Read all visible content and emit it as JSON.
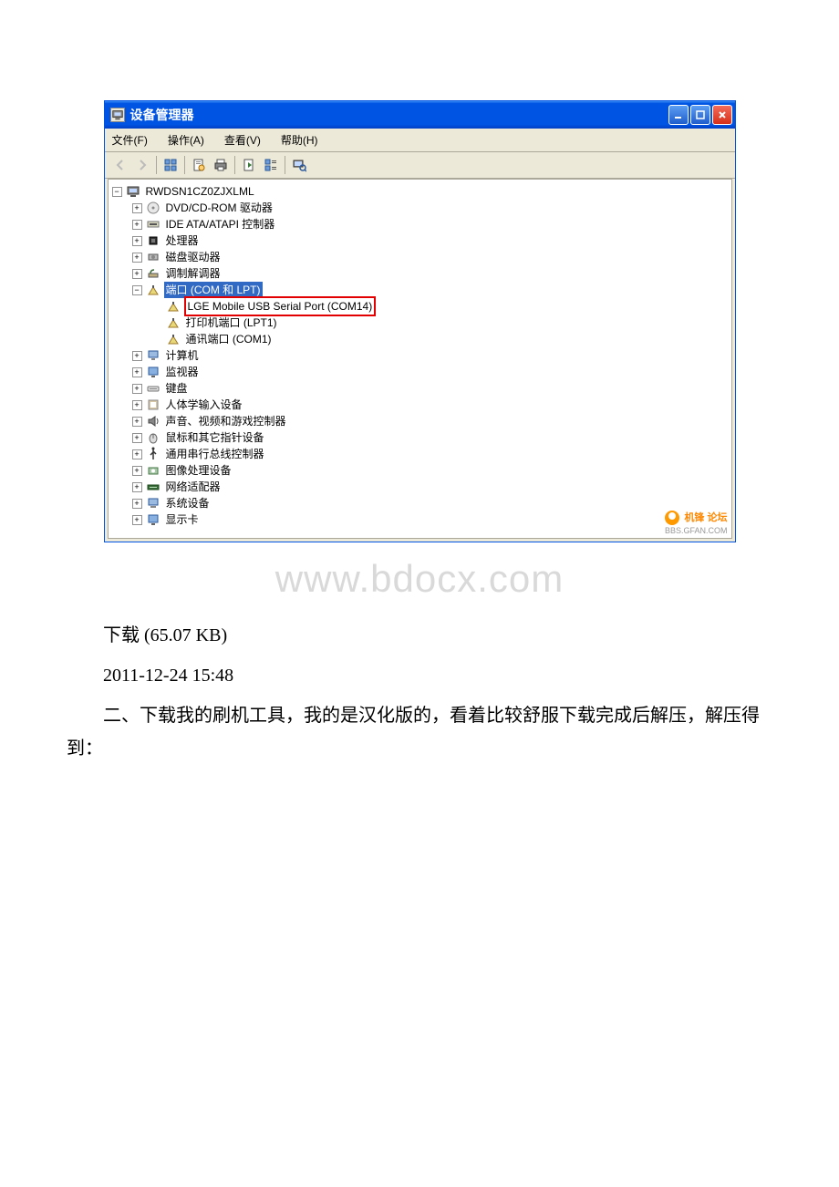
{
  "window": {
    "title": "设备管理器",
    "icon": "device-manager-icon"
  },
  "menu": {
    "file": "文件(F)",
    "action": "操作(A)",
    "view": "查看(V)",
    "help": "帮助(H)"
  },
  "toolbar": {
    "back": "back",
    "forward": "forward",
    "up": "up",
    "properties": "properties",
    "print": "print",
    "refresh": "refresh",
    "details": "details",
    "scan": "scan"
  },
  "tree": {
    "root": "RWDSN1CZ0ZJXLML",
    "nodes": [
      {
        "label": "DVD/CD-ROM 驱动器",
        "icon": "cdrom-icon"
      },
      {
        "label": "IDE ATA/ATAPI 控制器",
        "icon": "ide-icon"
      },
      {
        "label": "处理器",
        "icon": "cpu-icon"
      },
      {
        "label": "磁盘驱动器",
        "icon": "disk-icon"
      },
      {
        "label": "调制解调器",
        "icon": "modem-icon"
      },
      {
        "label": "端口 (COM 和 LPT)",
        "icon": "port-icon",
        "selected": true,
        "expanded": true,
        "children": [
          {
            "label": "LGE Mobile USB Serial Port (COM14)",
            "icon": "port-icon",
            "redbox": true
          },
          {
            "label": "打印机端口 (LPT1)",
            "icon": "port-icon"
          },
          {
            "label": "通讯端口 (COM1)",
            "icon": "port-icon"
          }
        ]
      },
      {
        "label": "计算机",
        "icon": "computer-icon"
      },
      {
        "label": "监视器",
        "icon": "monitor-icon"
      },
      {
        "label": "键盘",
        "icon": "keyboard-icon"
      },
      {
        "label": "人体学输入设备",
        "icon": "hid-icon"
      },
      {
        "label": "声音、视频和游戏控制器",
        "icon": "sound-icon"
      },
      {
        "label": "鼠标和其它指针设备",
        "icon": "mouse-icon"
      },
      {
        "label": "通用串行总线控制器",
        "icon": "usb-icon"
      },
      {
        "label": "图像处理设备",
        "icon": "imaging-icon"
      },
      {
        "label": "网络适配器",
        "icon": "network-icon"
      },
      {
        "label": "系统设备",
        "icon": "system-icon"
      },
      {
        "label": "显示卡",
        "icon": "display-icon"
      }
    ]
  },
  "forum_watermark": {
    "main": "机锋 论坛",
    "sub": "BBS.GFAN.COM"
  },
  "page_watermark": "www.bdocx.com",
  "article": {
    "download_line": "下载 (65.07 KB)",
    "timestamp": "2011-12-24 15:48",
    "paragraph1": "二、下载我的刷机工具，我的是汉化版的，看着比较舒服下载完成后解压，解压得到："
  }
}
